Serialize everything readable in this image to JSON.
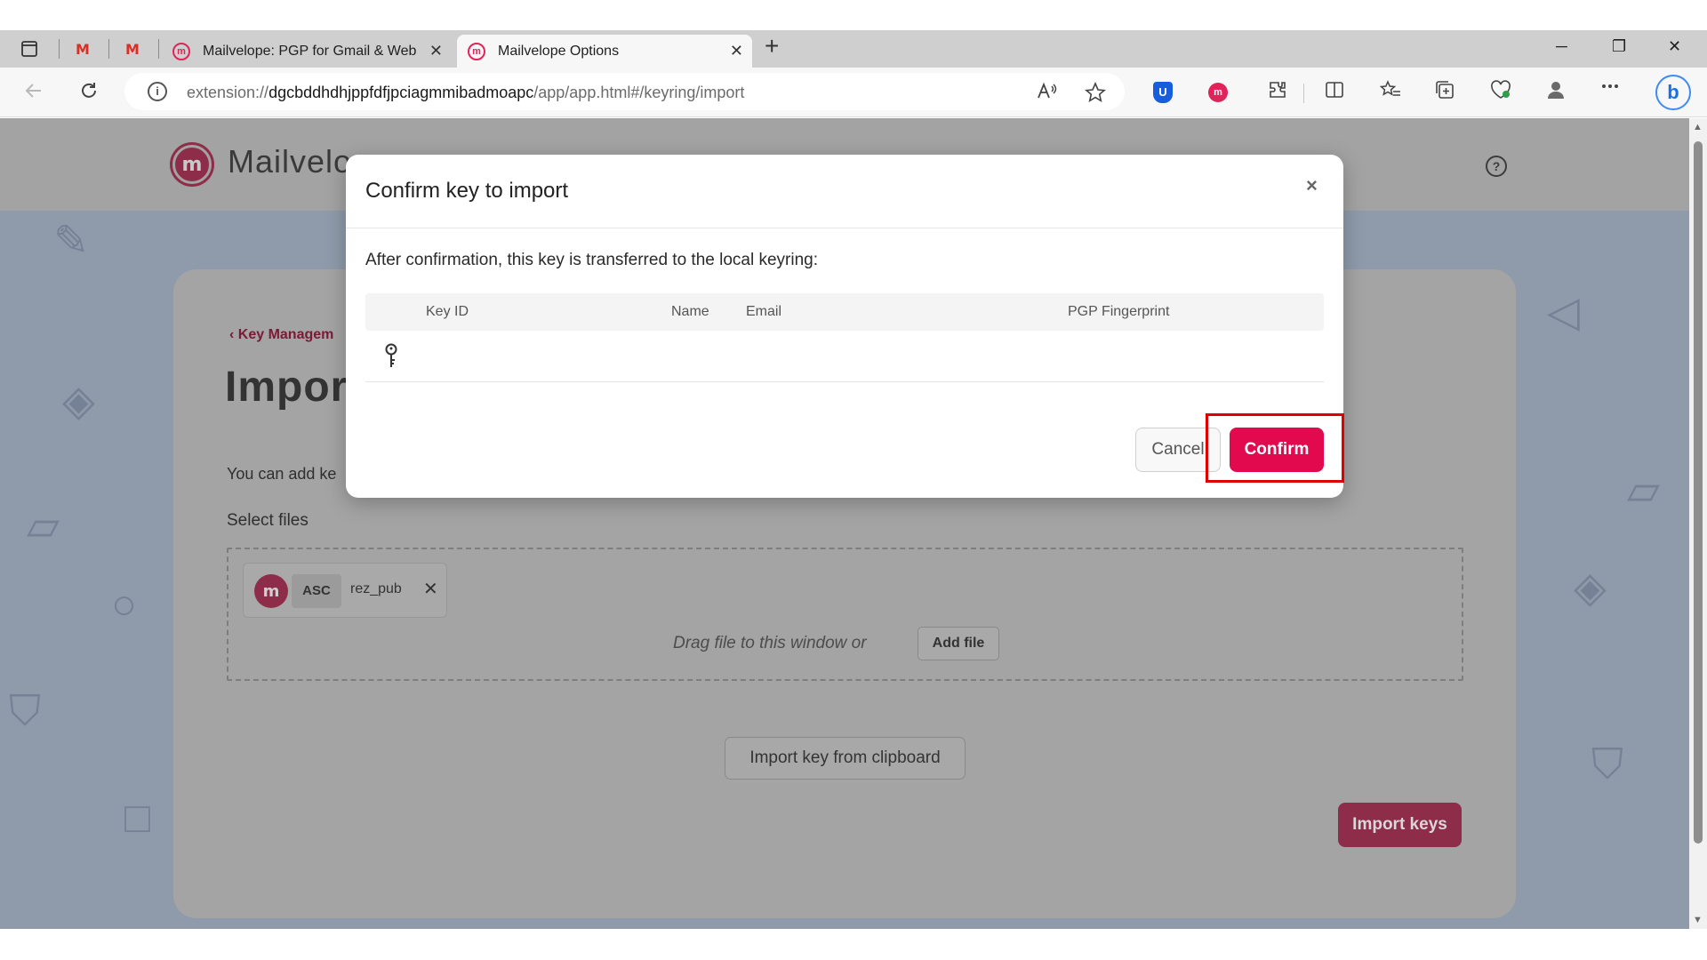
{
  "browser": {
    "tabs": [
      {
        "title": "Mailvelope: PGP for Gmail & Web",
        "active": false
      },
      {
        "title": "Mailvelope Options",
        "active": true
      }
    ],
    "gmail_glyph": "M",
    "new_tab_glyph": "+",
    "tab_close_glyph": "✕",
    "url": {
      "scheme": "extension://",
      "host": "dgcbddhdhjppfdfjpciagmmibadmoapc",
      "path": "/app/app.html#/keyring/import"
    },
    "info_glyph": "i",
    "window_controls": {
      "minimize": "─",
      "restore": "❐",
      "close": "✕"
    },
    "icons": [
      "sidebar-icon",
      "gmail-icon",
      "gmail-icon",
      "back-icon",
      "refresh-icon",
      "info-icon",
      "read-aloud-icon",
      "favorite-icon",
      "bitwarden-icon",
      "mailvelope-icon",
      "extensions-icon",
      "split-screen-icon",
      "favorites-icon",
      "collections-icon",
      "browser-essentials-icon",
      "profile-icon",
      "more-icon",
      "bing-icon"
    ]
  },
  "app": {
    "logo_letter": "m",
    "brand": "Mailvelo",
    "help_glyph": "?",
    "breadcrumb": "Key Managem",
    "title": "Impor",
    "intro": "You can add ke",
    "select_files_label": "Select files",
    "file": {
      "ext": "ASC",
      "name": "rez_pub",
      "remove_glyph": "✕"
    },
    "drag_text": "Drag file to this window or",
    "add_file_label": "Add file",
    "clipboard_label": "Import key from clipboard",
    "import_keys_label": "Import keys",
    "colors": {
      "brand": "#e2094f",
      "overlay_brand": "#8e2d49"
    }
  },
  "modal": {
    "title": "Confirm key to import",
    "close_glyph": "×",
    "message": "After confirmation, this key is transferred to the local keyring:",
    "table": {
      "headers": [
        "Key ID",
        "Name",
        "Email",
        "PGP Fingerprint"
      ],
      "rows": [
        {
          "key_id": "",
          "name": "",
          "email": "",
          "fingerprint": ""
        }
      ]
    },
    "cancel_label": "Cancel",
    "confirm_label": "Confirm"
  }
}
